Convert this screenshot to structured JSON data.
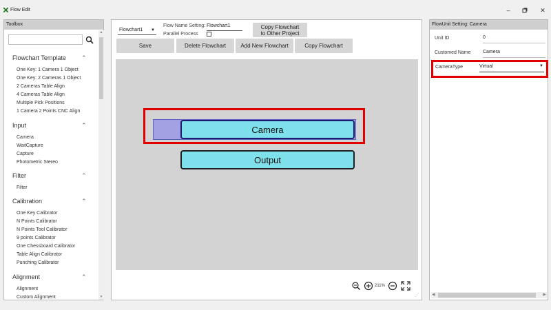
{
  "window": {
    "title": "Flow Edit",
    "minimize": "–",
    "maximize": "▫",
    "close": "✕"
  },
  "toolbox": {
    "header": "Toolbox",
    "search_placeholder": "",
    "categories": [
      {
        "label": "Flowchart Template",
        "items": [
          "One Key: 1 Camera 1 Object",
          "One Key: 2 Cameras 1 Object",
          "2 Cameras Table Align",
          "4 Cameras Table Align",
          "Multiple Pick Positions",
          "1 Camera 2 Points CNC Align"
        ]
      },
      {
        "label": "Input",
        "items": [
          "Camera",
          "WaitCapture",
          "Capture",
          "Photometric Stereo"
        ]
      },
      {
        "label": "Filter",
        "items": [
          "Filter"
        ]
      },
      {
        "label": "Calibration",
        "items": [
          "One Key Calibrator",
          "N Points Calibrator",
          "N Points Tool Calibrator",
          "9 points Calibrator",
          "One Chessboard Calibrator",
          "Table Align Calibrator",
          "Punching Calibrator"
        ]
      },
      {
        "label": "Alignment",
        "items": [
          "Alignment",
          "Custom Alignment"
        ]
      }
    ]
  },
  "editor": {
    "flowchart_select": "Flowchart1",
    "flow_name_label": "Flow Name Setting:",
    "flow_name_value": "Flowchart1",
    "parallel_label": "Parallel Process",
    "copy_other_line1": "Copy Flowchart",
    "copy_other_line2": "to Other Project",
    "buttons": {
      "save": "Save",
      "delete": "Delete Flowchart",
      "add": "Add New Flowchart",
      "copy": "Copy Flowchart"
    },
    "nodes": {
      "camera": "Camera",
      "output": "Output"
    },
    "zoom_level": "211%"
  },
  "properties": {
    "header": "FlowUnit Setting:  Camera",
    "unit_id_label": "Unit ID",
    "unit_id_value": "0",
    "custom_name_label": "Customed Name",
    "custom_name_value": "Camera",
    "camera_type_label": "CameraType",
    "camera_type_value": "Virtual"
  },
  "colors": {
    "node_fill": "#7ee0ea",
    "selection_red": "#e00000",
    "node_shadow": "#a4a0e4"
  }
}
